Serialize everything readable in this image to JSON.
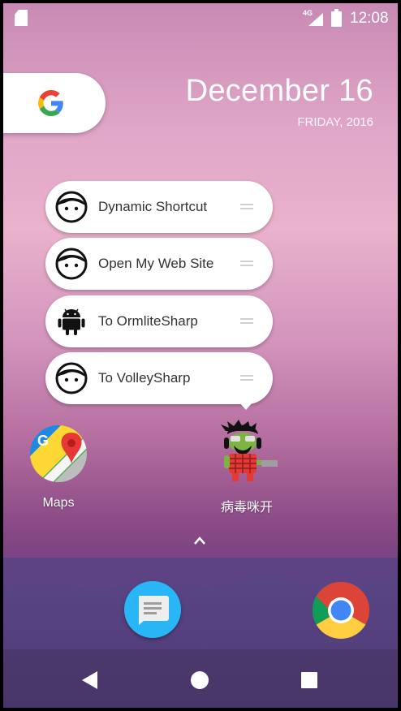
{
  "status_bar": {
    "network_label": "4G",
    "time": "12:08",
    "icons": [
      "sd-card-icon",
      "signal-icon",
      "battery-icon"
    ]
  },
  "search_widget": {
    "icon": "google-g-icon"
  },
  "date_widget": {
    "date": "December 16",
    "weekday_year": "FRIDAY, 2016"
  },
  "shortcuts": [
    {
      "label": "Dynamic Shortcut",
      "icon": "face-icon"
    },
    {
      "label": "Open My Web Site",
      "icon": "face-icon"
    },
    {
      "label": "To OrmliteSharp",
      "icon": "android-icon"
    },
    {
      "label": "To VolleySharp",
      "icon": "face-icon"
    }
  ],
  "apps": [
    {
      "label": "Maps",
      "icon": "maps-icon"
    },
    {
      "label": "病毒咪开",
      "icon": "virus-mikai-icon"
    }
  ],
  "dock": [
    {
      "name": "Messages",
      "icon": "messages-icon"
    },
    {
      "name": "Chrome",
      "icon": "chrome-icon"
    }
  ],
  "colors": {
    "wallpaper_top": "#c88ab4",
    "wallpaper_bottom": "#4f3670",
    "popup_bg": "#ffffff",
    "messages_blue": "#29b6f6"
  }
}
